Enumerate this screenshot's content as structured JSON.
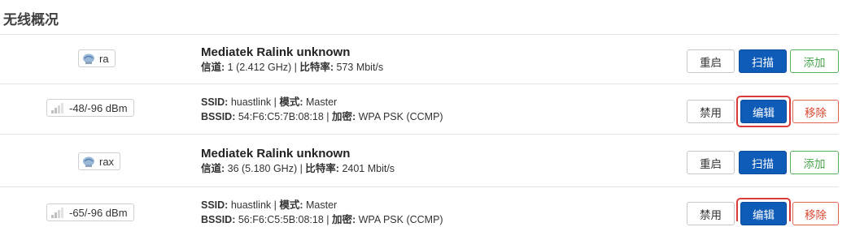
{
  "section_title": "无线概况",
  "devices": [
    {
      "radio_label": "ra",
      "name": "Mediatek Ralink unknown",
      "channel_key": "信道:",
      "channel_value": " 1 (2.412 GHz) | ",
      "bitrate_key": "比特率:",
      "bitrate_value": " 573 Mbit/s",
      "buttons": {
        "restart": "重启",
        "scan": "扫描",
        "add": "添加"
      },
      "network": {
        "signal": "-48/-96 dBm",
        "ssid_key": "SSID:",
        "ssid_value": " huastlink | ",
        "mode_key": "模式:",
        "mode_value": " Master",
        "bssid_key": "BSSID:",
        "bssid_value": " 54:F6:C5:7B:08:18 | ",
        "enc_key": "加密:",
        "enc_value": " WPA PSK (CCMP)",
        "buttons": {
          "disable": "禁用",
          "edit": "编辑",
          "remove": "移除"
        }
      }
    },
    {
      "radio_label": "rax",
      "name": "Mediatek Ralink unknown",
      "channel_key": "信道:",
      "channel_value": " 36 (5.180 GHz) | ",
      "bitrate_key": "比特率:",
      "bitrate_value": " 2401 Mbit/s",
      "buttons": {
        "restart": "重启",
        "scan": "扫描",
        "add": "添加"
      },
      "network": {
        "signal": "-65/-96 dBm",
        "ssid_key": "SSID:",
        "ssid_value": " huastlink | ",
        "mode_key": "模式:",
        "mode_value": " Master",
        "bssid_key": "BSSID:",
        "bssid_value": " 56:F6:C5:5B:08:18 | ",
        "enc_key": "加密:",
        "enc_value": " WPA PSK (CCMP)",
        "buttons": {
          "disable": "禁用",
          "edit": "编辑",
          "remove": "移除"
        }
      }
    }
  ],
  "colors": {
    "primary": "#0e5bb8",
    "success": "#4aa64e",
    "danger": "#d9452e",
    "highlight": "#d93a3a"
  }
}
